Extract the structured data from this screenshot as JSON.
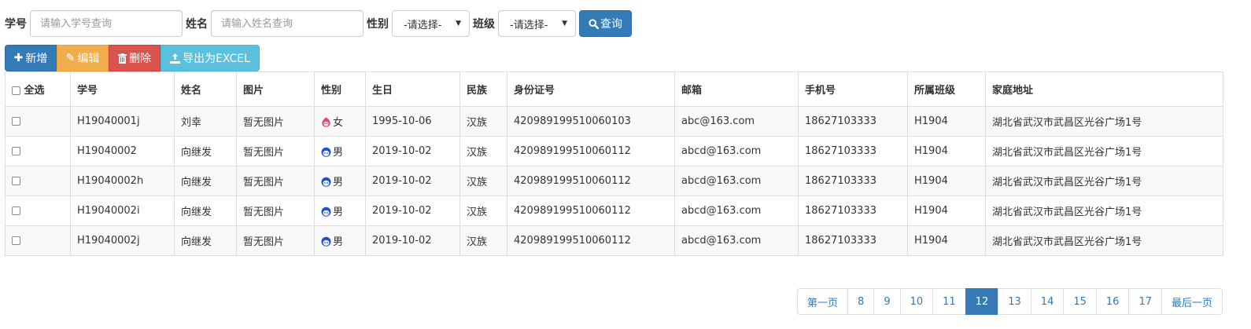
{
  "search": {
    "id_label": "学号",
    "id_placeholder": "请输入学号查询",
    "name_label": "姓名",
    "name_placeholder": "请输入姓名查询",
    "gender_label": "性别",
    "gender_value": "-请选择-",
    "class_label": "班级",
    "class_value": "-请选择-",
    "query_label": "查询"
  },
  "toolbar": {
    "add_label": "新增",
    "edit_label": "编辑",
    "delete_label": "删除",
    "export_label": "导出为EXCEL"
  },
  "table": {
    "headers": {
      "select_all": "全选",
      "id": "学号",
      "name": "姓名",
      "photo": "图片",
      "gender": "性别",
      "birthday": "生日",
      "ethnicity": "民族",
      "id_card": "身份证号",
      "email": "邮箱",
      "phone": "手机号",
      "class": "所属班级",
      "address": "家庭地址"
    },
    "rows": [
      {
        "id": "H19040001j",
        "name": "刘幸",
        "photo": "暂无图片",
        "gender": "女",
        "birthday": "1995-10-06",
        "ethnicity": "汉族",
        "id_card": "420989199510060103",
        "email": "abc@163.com",
        "phone": "18627103333",
        "class": "H1904",
        "address": "湖北省武汉市武昌区光谷广场1号"
      },
      {
        "id": "H19040002",
        "name": "向继发",
        "photo": "暂无图片",
        "gender": "男",
        "birthday": "2019-10-02",
        "ethnicity": "汉族",
        "id_card": "420989199510060112",
        "email": "abcd@163.com",
        "phone": "18627103333",
        "class": "H1904",
        "address": "湖北省武汉市武昌区光谷广场1号"
      },
      {
        "id": "H19040002h",
        "name": "向继发",
        "photo": "暂无图片",
        "gender": "男",
        "birthday": "2019-10-02",
        "ethnicity": "汉族",
        "id_card": "420989199510060112",
        "email": "abcd@163.com",
        "phone": "18627103333",
        "class": "H1904",
        "address": "湖北省武汉市武昌区光谷广场1号"
      },
      {
        "id": "H19040002i",
        "name": "向继发",
        "photo": "暂无图片",
        "gender": "男",
        "birthday": "2019-10-02",
        "ethnicity": "汉族",
        "id_card": "420989199510060112",
        "email": "abcd@163.com",
        "phone": "18627103333",
        "class": "H1904",
        "address": "湖北省武汉市武昌区光谷广场1号"
      },
      {
        "id": "H19040002j",
        "name": "向继发",
        "photo": "暂无图片",
        "gender": "男",
        "birthday": "2019-10-02",
        "ethnicity": "汉族",
        "id_card": "420989199510060112",
        "email": "abcd@163.com",
        "phone": "18627103333",
        "class": "H1904",
        "address": "湖北省武汉市武昌区光谷广场1号"
      }
    ]
  },
  "pagination": {
    "first_label": "第一页",
    "last_label": "最后一页",
    "pages": [
      "8",
      "9",
      "10",
      "11",
      "12",
      "13",
      "14",
      "15",
      "16",
      "17"
    ],
    "current": "12"
  },
  "colors": {
    "primary": "#337ab7",
    "warning": "#f0ad4e",
    "danger": "#d9534f",
    "info": "#5bc0de",
    "female_icon": "#e8407a",
    "male_icon": "#1a4fd6"
  }
}
